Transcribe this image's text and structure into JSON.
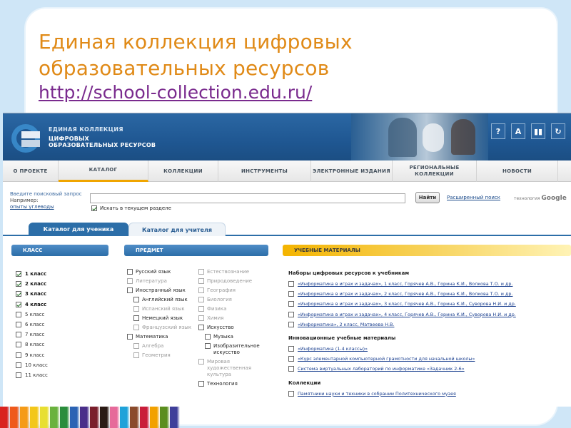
{
  "slide": {
    "title": "Единая коллекция цифровых образовательных ресурсов",
    "url": "http://school-collection.edu.ru/"
  },
  "site": {
    "logo": {
      "line1": "ЕДИНАЯ КОЛЛЕКЦИЯ",
      "line2": "ЦИФРОВЫХ",
      "line3": "ОБРАЗОВАТЕЛЬНЫХ РЕСУРСОВ"
    },
    "header_icons": [
      "?",
      "A",
      "▮▮",
      "↻"
    ],
    "menu": [
      {
        "label": "О ПРОЕКТЕ",
        "active": false
      },
      {
        "label": "КАТАЛОГ",
        "active": true
      },
      {
        "label": "КОЛЛЕКЦИИ",
        "active": false
      },
      {
        "label": "ИНСТРУМЕНТЫ",
        "active": false
      },
      {
        "label": "ЭЛЕКТРОННЫЕ ИЗДАНИЯ",
        "active": false
      },
      {
        "label": "РЕГИОНАЛЬНЫЕ КОЛЛЕКЦИИ",
        "active": false
      },
      {
        "label": "НОВОСТИ",
        "active": false
      }
    ],
    "search": {
      "hint": "Введите поисковый запрос",
      "example_label": "Например:",
      "example_link": "опыты углеводы",
      "input_value": "",
      "button": "Найти",
      "advanced": "Расширенный поиск",
      "tech_label": "технология",
      "tech_brand": "Google",
      "scope_label": "Искать в текущем разделе",
      "scope_checked": true
    },
    "catalog_tabs": {
      "student": "Каталог для ученика",
      "teacher": "Каталог для учителя"
    },
    "panels": {
      "grade": "КЛАСС",
      "subject": "ПРЕДМЕТ",
      "materials": "УЧЕБНЫЕ МАТЕРИАЛЫ"
    },
    "grades": [
      {
        "label": "1 класс",
        "checked": true
      },
      {
        "label": "2 класс",
        "checked": true
      },
      {
        "label": "3 класс",
        "checked": true
      },
      {
        "label": "4 класс",
        "checked": true
      },
      {
        "label": "5 класс",
        "checked": false
      },
      {
        "label": "6 класс",
        "checked": false
      },
      {
        "label": "7 класс",
        "checked": false
      },
      {
        "label": "8 класс",
        "checked": false
      },
      {
        "label": "9 класс",
        "checked": false
      },
      {
        "label": "10 класс",
        "checked": false
      },
      {
        "label": "11 класс",
        "checked": false
      }
    ],
    "subjects_col1": [
      {
        "label": "Русский язык",
        "disabled": false,
        "indent": false
      },
      {
        "label": "Литература",
        "disabled": true,
        "indent": false
      },
      {
        "label": "Иностранный язык",
        "disabled": false,
        "indent": false
      },
      {
        "label": "Английский язык",
        "disabled": false,
        "indent": true
      },
      {
        "label": "Испанский язык",
        "disabled": true,
        "indent": true
      },
      {
        "label": "Немецкий язык",
        "disabled": false,
        "indent": true
      },
      {
        "label": "Французский язык",
        "disabled": true,
        "indent": true
      },
      {
        "label": "Математика",
        "disabled": false,
        "indent": false
      },
      {
        "label": "Алгебра",
        "disabled": true,
        "indent": true
      },
      {
        "label": "Геометрия",
        "disabled": true,
        "indent": true
      }
    ],
    "subjects_col2": [
      {
        "label": "Естествознание",
        "disabled": true,
        "indent": false
      },
      {
        "label": "Природоведение",
        "disabled": true,
        "indent": false
      },
      {
        "label": "География",
        "disabled": true,
        "indent": false
      },
      {
        "label": "Биология",
        "disabled": true,
        "indent": false
      },
      {
        "label": "Физика",
        "disabled": true,
        "indent": false
      },
      {
        "label": "Химия",
        "disabled": true,
        "indent": false
      },
      {
        "label": "Искусство",
        "disabled": false,
        "indent": false
      },
      {
        "label": "Музыка",
        "disabled": false,
        "indent": true
      },
      {
        "label": "Изобразительное искусство",
        "disabled": false,
        "indent": true
      },
      {
        "label": "Мировая художественная культура",
        "disabled": true,
        "indent": false
      },
      {
        "label": "Технология",
        "disabled": false,
        "indent": false
      }
    ],
    "materials": [
      {
        "group": "Наборы цифровых ресурсов к учебникам",
        "items": [
          "«Информатика в играх и задачах», 1 класс, Горячев А.В., Горина К.И., Волкова Т.О. и др.",
          "«Информатика в играх и задачах», 2 класс, Горячев А.В., Горина К.И., Волкова Т.О. и др.",
          "«Информатика в играх и задачах», 3 класс, Горячев А.В., Горина К.И., Суворова Н.И. и др.",
          "«Информатика в играх и задачах», 4 класс, Горячев А.В., Горина К.И., Суворова Н.И. и др.",
          "«Информатика», 2 класс, Матвеева Н.В."
        ]
      },
      {
        "group": "Инновационные учебные материалы",
        "items": [
          "«Информатика (1-4 классы)»",
          "«Курс элементарной компьютерной грамотности для начальной школы»",
          "Система виртуальных лабораторий по информатике «Задачник 2-6»"
        ]
      },
      {
        "group": "Коллекции",
        "items": [
          "Памятники науки и техники в собрании Политехнического музея"
        ]
      }
    ]
  },
  "colors": {
    "title": "#e08a17",
    "url": "#7a2b8e",
    "header_blue": "#1f5792",
    "tab_blue": "#2c6ea8",
    "accent_yellow": "#f4b400",
    "link": "#1a3f8f"
  },
  "crayon_colors": [
    "#d9231f",
    "#ef5a1c",
    "#f59b17",
    "#f3c71a",
    "#e8df31",
    "#6ab23e",
    "#2a8d3c",
    "#2b63b4",
    "#4a2f8a",
    "#7a1f2c",
    "#2b1b15",
    "#e66a9a",
    "#1fa2d9",
    "#8b4b2c",
    "#c91e3a",
    "#f2a100",
    "#5b8e1f",
    "#3f3f9a"
  ]
}
